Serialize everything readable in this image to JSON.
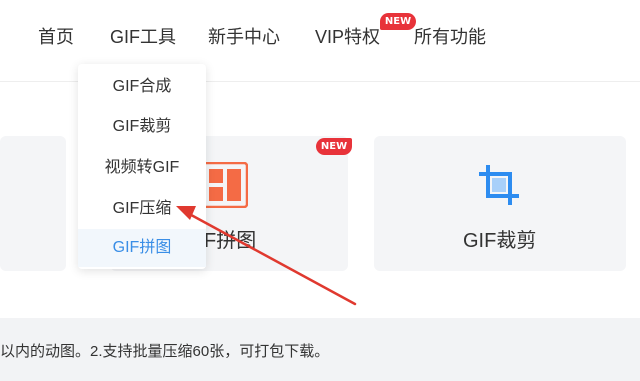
{
  "nav": {
    "items": [
      {
        "label": "首页"
      },
      {
        "label": "GIF工具"
      },
      {
        "label": "新手中心"
      },
      {
        "label": "VIP特权"
      },
      {
        "label": "所有功能"
      }
    ],
    "new_badge": "NEW"
  },
  "dropdown": {
    "items": [
      {
        "label": "GIF合成"
      },
      {
        "label": "GIF裁剪"
      },
      {
        "label": "视频转GIF"
      },
      {
        "label": "GIF压缩"
      },
      {
        "label": "GIF拼图"
      }
    ],
    "active_index": 4
  },
  "cards": [
    {
      "title": "F拼图",
      "badge": "NEW",
      "icon": "collage-icon"
    },
    {
      "title": "GIF裁剪",
      "icon": "crop-icon"
    }
  ],
  "description": "以内的动图。2.支持批量压缩60张，可打包下载。",
  "colors": {
    "accent_blue": "#3a8ee6",
    "badge_red": "#e8333a",
    "arrow_red": "#e0392f",
    "collage_orange": "#f46b45",
    "crop_blue": "#2d8cf0"
  }
}
